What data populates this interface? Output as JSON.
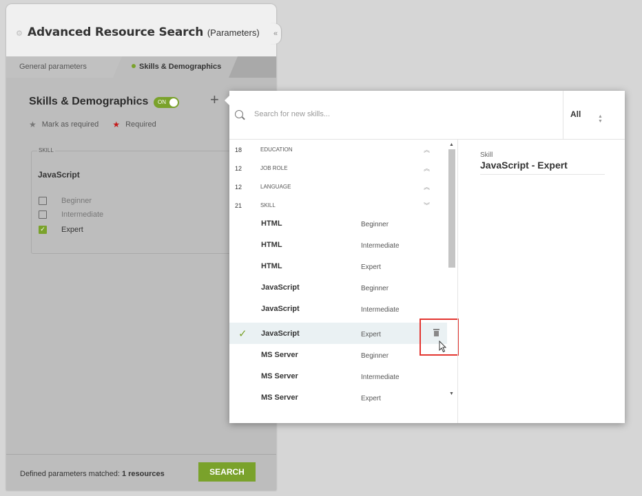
{
  "panel": {
    "title": "Advanced Resource Search",
    "subtitle": "(Parameters)",
    "collapse_icon": "«",
    "tabs": [
      "General parameters",
      "Skills & Demographics"
    ],
    "section_title": "Skills & Demographics",
    "toggle_label": "ON",
    "add_icon": "+",
    "legend_mark": "Mark as required",
    "legend_required": "Required",
    "skill_box_label": "SKILL",
    "skill_name": "JavaScript",
    "levels": [
      {
        "label": "Beginner",
        "checked": false
      },
      {
        "label": "Intermediate",
        "checked": false
      },
      {
        "label": "Expert",
        "checked": true
      }
    ],
    "footer_prefix": "Defined parameters matched: ",
    "footer_count": "1 resources",
    "search_button": "SEARCH"
  },
  "popup": {
    "search_placeholder": "Search for new skills...",
    "filter_value": "All",
    "categories": [
      {
        "count": "18",
        "label": "EDUCATION",
        "arrow": "≈"
      },
      {
        "count": "12",
        "label": "JOB ROLE",
        "arrow": "≈"
      },
      {
        "count": "12",
        "label": "LANGUAGE",
        "arrow": "≈"
      },
      {
        "count": "21",
        "label": "SKILL",
        "arrow": "≈"
      }
    ],
    "rows": [
      {
        "name": "HTML",
        "level": "Beginner"
      },
      {
        "name": "HTML",
        "level": "Intermediate"
      },
      {
        "name": "HTML",
        "level": "Expert"
      },
      {
        "name": "JavaScript",
        "level": "Beginner"
      },
      {
        "name": "JavaScript",
        "level": "Intermediate"
      },
      {
        "name": "JavaScript",
        "level": "Expert",
        "selected": true
      },
      {
        "name": "MS Server",
        "level": "Beginner"
      },
      {
        "name": "MS Server",
        "level": "Intermediate"
      },
      {
        "name": "MS Server",
        "level": "Expert"
      }
    ],
    "detail_label": "Skill",
    "detail_value": "JavaScript - Expert"
  },
  "colors": {
    "accent": "#7aa22b",
    "required": "#c41a1a",
    "highlight": "#e3342f"
  }
}
